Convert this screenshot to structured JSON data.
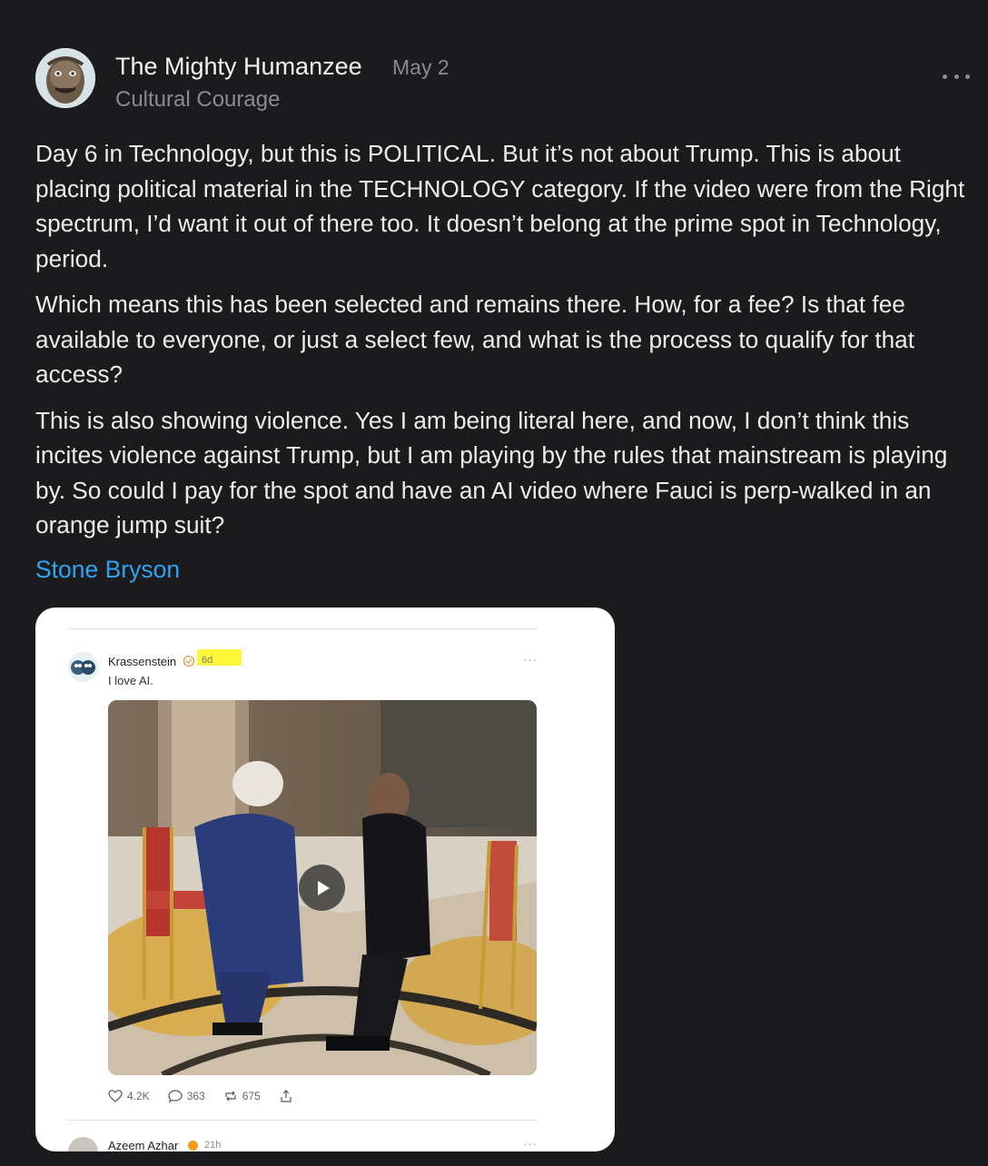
{
  "post": {
    "author": "The Mighty Humanzee",
    "date": "May 2",
    "publication": "Cultural Courage",
    "paragraphs": [
      "Day 6 in Technology, but this is POLITICAL. But it’s not about Trump. This is about placing political material in the TECHNOLOGY category. If the video were from the Right spectrum, I’d want it out of there too. It doesn’t belong at the prime spot in Technology, period.",
      "Which means this has been selected and remains there. How, for a fee? Is that fee available to everyone, or just a select few, and what is the process to qualify for that access?",
      "This is also showing violence. Yes I am being literal here, and now, I don’t think this incites violence against Trump, but I am playing by the rules that mainstream is playing by. So could I pay for the spot and have an AI video where Fauci is perp-walked in an orange jump suit?"
    ],
    "mention": "Stone Bryson"
  },
  "embed": {
    "tweet": {
      "author": "Krassenstein",
      "age": "6d",
      "text": "I love AI.",
      "likes": "4.2K",
      "replies": "363",
      "reposts": "675"
    },
    "next_tweet": {
      "author": "Azeem Azhar",
      "age": "21h"
    }
  },
  "colors": {
    "background": "#1b1b1d",
    "mention_link": "#2fa3f2",
    "highlight": "#fff53a"
  }
}
